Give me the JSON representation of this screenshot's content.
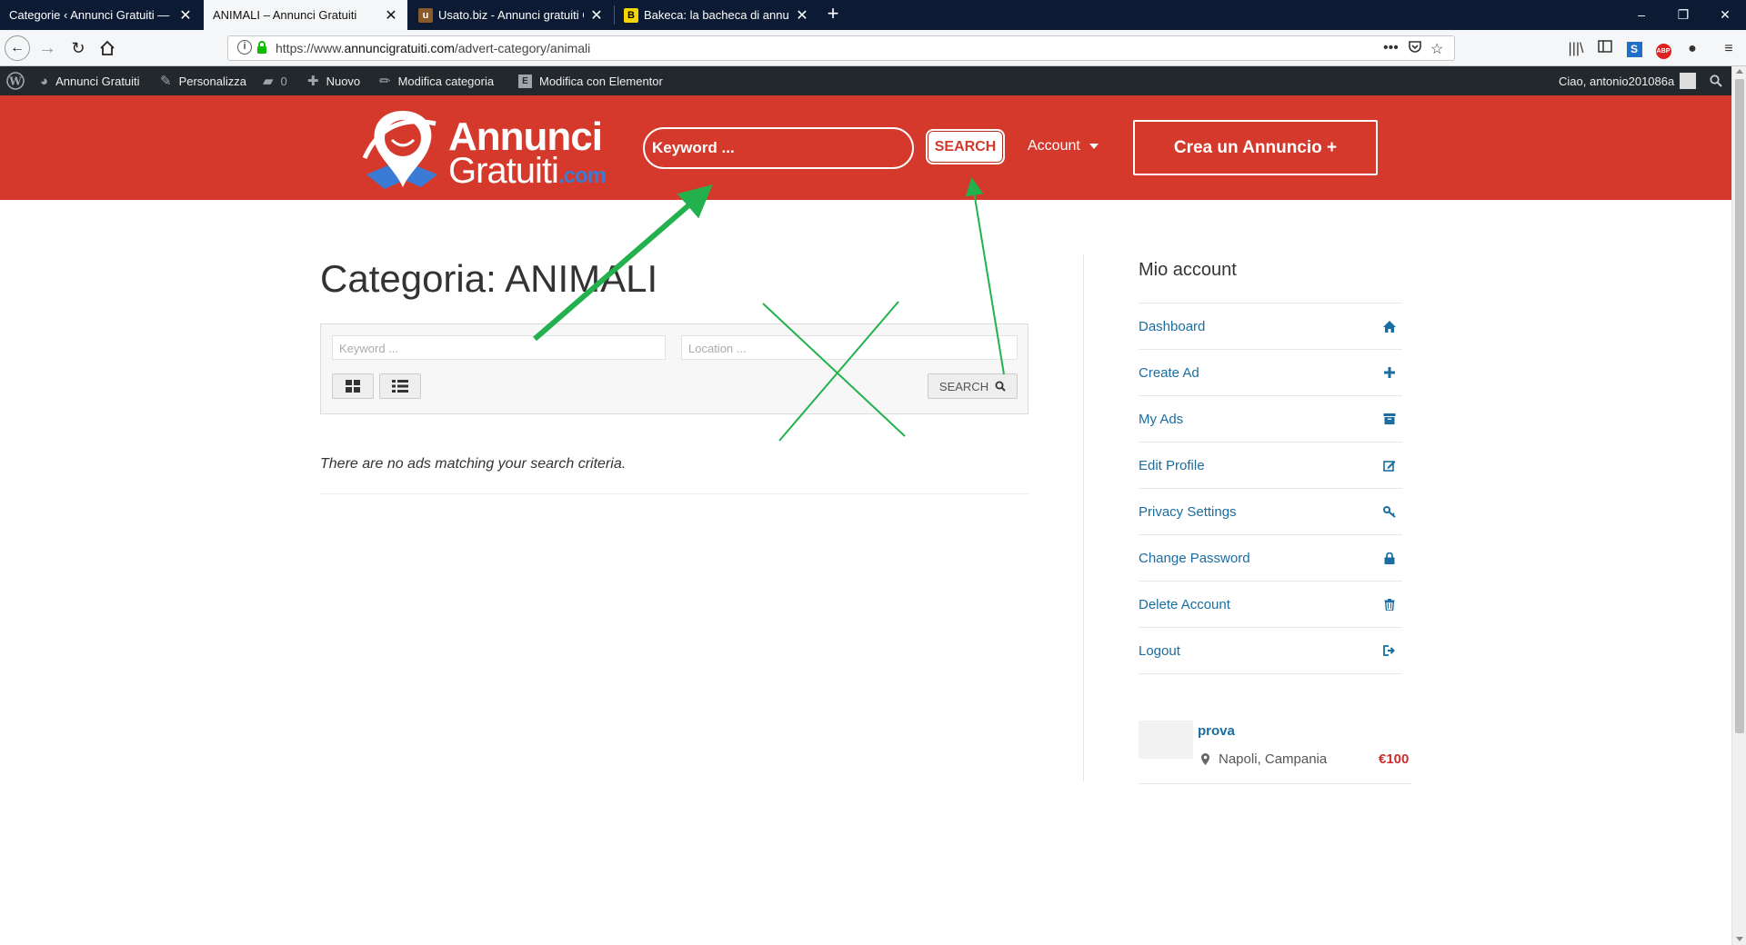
{
  "browser": {
    "tabs": [
      {
        "title": "Categorie ‹ Annunci Gratuiti — Wo",
        "active": false
      },
      {
        "title": "ANIMALI – Annunci Gratuiti",
        "active": true
      },
      {
        "title": "Usato.biz - Annunci gratuiti Ca",
        "active": false
      },
      {
        "title": "Bakeca: la bacheca di annunci g",
        "active": false
      }
    ],
    "url": {
      "prefix": "https://www.",
      "host": "annuncigratuiti.com",
      "path": "/advert-category/animali"
    }
  },
  "wp_admin_bar": {
    "site_name": "Annunci Gratuiti",
    "customize": "Personalizza",
    "comments_count": "0",
    "new": "Nuovo",
    "edit_category": "Modifica categoria",
    "edit_elementor": "Modifica con Elementor",
    "greeting": "Ciao, antonio201086a"
  },
  "header": {
    "logo_line1": "Annunci",
    "logo_line2": "Gratuiti",
    "logo_suffix": ".com",
    "search_placeholder": "Keyword ...",
    "search_button": "SEARCH",
    "account": "Account",
    "create_ad": "Crea un Annuncio +"
  },
  "main": {
    "title": "Categoria: ANIMALI",
    "filter": {
      "keyword_placeholder": "Keyword ...",
      "location_placeholder": "Location ...",
      "search_button": "SEARCH"
    },
    "no_results": "There are no ads matching your search criteria."
  },
  "sidebar": {
    "title": "Mio account",
    "items": [
      {
        "label": "Dashboard",
        "icon": "home-icon"
      },
      {
        "label": "Create Ad",
        "icon": "plus-icon"
      },
      {
        "label": "My Ads",
        "icon": "archive-icon"
      },
      {
        "label": "Edit Profile",
        "icon": "edit-icon"
      },
      {
        "label": "Privacy Settings",
        "icon": "key-icon"
      },
      {
        "label": "Change Password",
        "icon": "lock-icon"
      },
      {
        "label": "Delete Account",
        "icon": "trash-icon"
      },
      {
        "label": "Logout",
        "icon": "sign-out-icon"
      }
    ],
    "ad": {
      "title": "prova",
      "location": "Napoli, Campania",
      "price": "€100"
    }
  },
  "colors": {
    "brand_red": "#d5392c",
    "link_blue": "#1a6da1",
    "annotation_green": "#22b14c"
  }
}
